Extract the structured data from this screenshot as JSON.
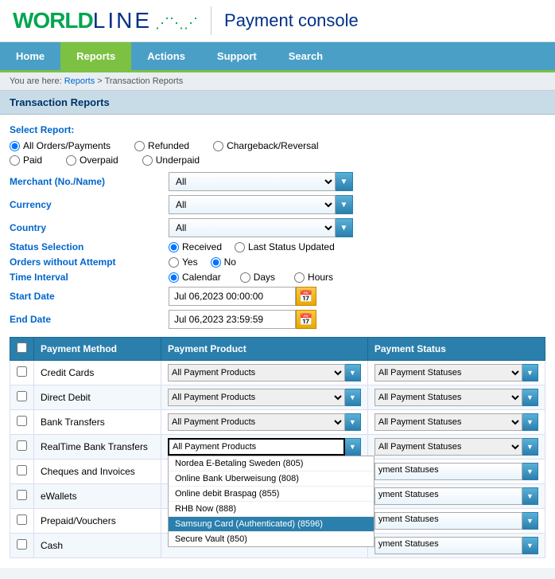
{
  "header": {
    "logo_world": "WORLD",
    "logo_line": "LINE",
    "logo_waves": "ʃʃʃ",
    "title": "Payment console"
  },
  "nav": {
    "items": [
      {
        "id": "home",
        "label": "Home",
        "active": false
      },
      {
        "id": "reports",
        "label": "Reports",
        "active": true
      },
      {
        "id": "actions",
        "label": "Actions",
        "active": false
      },
      {
        "id": "support",
        "label": "Support",
        "active": false
      },
      {
        "id": "search",
        "label": "Search",
        "active": false
      }
    ]
  },
  "breadcrumb": {
    "prefix": "You are here:",
    "links": [
      "Reports",
      "Transaction Reports"
    ]
  },
  "page_title": "Transaction Reports",
  "form": {
    "select_report_label": "Select Report:",
    "report_options_row1": [
      {
        "id": "all_orders",
        "label": "All Orders/Payments",
        "checked": true
      },
      {
        "id": "refunded",
        "label": "Refunded",
        "checked": false
      },
      {
        "id": "chargeback",
        "label": "Chargeback/Reversal",
        "checked": false
      }
    ],
    "report_options_row2": [
      {
        "id": "paid",
        "label": "Paid",
        "checked": false
      },
      {
        "id": "overpaid",
        "label": "Overpaid",
        "checked": false
      },
      {
        "id": "underpaid",
        "label": "Underpaid",
        "checked": false
      }
    ],
    "merchant_label": "Merchant (No./Name)",
    "merchant_value": "All",
    "currency_label": "Currency",
    "currency_value": "All",
    "country_label": "Country",
    "country_value": "All",
    "status_selection_label": "Status Selection",
    "status_options": [
      {
        "id": "received",
        "label": "Received",
        "checked": true
      },
      {
        "id": "last_status",
        "label": "Last Status Updated",
        "checked": false
      }
    ],
    "orders_without_label": "Orders without Attempt",
    "orders_without_options": [
      {
        "id": "yes",
        "label": "Yes",
        "checked": false
      },
      {
        "id": "no",
        "label": "No",
        "checked": true
      }
    ],
    "time_interval_label": "Time Interval",
    "time_interval_options": [
      {
        "id": "calendar",
        "label": "Calendar",
        "checked": true
      },
      {
        "id": "days",
        "label": "Days",
        "checked": false
      },
      {
        "id": "hours",
        "label": "Hours",
        "checked": false
      }
    ],
    "start_date_label": "Start Date",
    "start_date_value": "Jul 06,2023 00:00:00",
    "end_date_label": "End Date",
    "end_date_value": "Jul 06,2023 23:59:59"
  },
  "table": {
    "headers": [
      "",
      "Payment Method",
      "Payment Product",
      "Payment Status"
    ],
    "rows": [
      {
        "method": "Credit Cards",
        "product": "All Payment Products",
        "status": "All Payment Statuses"
      },
      {
        "method": "Direct Debit",
        "product": "All Payment Products",
        "status": "All Payment Statuses"
      },
      {
        "method": "Bank Transfers",
        "product": "All Payment Products",
        "status": "All Payment Statuses"
      },
      {
        "method": "RealTime Bank Transfers",
        "product": "All Payment Products",
        "status": "All Payment Statuses"
      },
      {
        "method": "Cheques and Invoices",
        "product": "",
        "status": "yment Statuses"
      },
      {
        "method": "eWallets",
        "product": "",
        "status": "yment Statuses"
      },
      {
        "method": "Prepaid/Vouchers",
        "product": "",
        "status": "yment Statuses"
      },
      {
        "method": "Cash",
        "product": "",
        "status": "yment Statuses"
      }
    ],
    "dropdown_open_row": 3,
    "dropdown_input_value": "All Payment Products",
    "dropdown_menu_items": [
      {
        "label": "Nordea E-Betaling Sweden (805)",
        "selected": false
      },
      {
        "label": "Online Bank Uberweisung (808)",
        "selected": false
      },
      {
        "label": "Online debit Braspag (855)",
        "selected": false
      },
      {
        "label": "RHB Now (888)",
        "selected": false
      },
      {
        "label": "Samsung Card (Authenticated) (8596)",
        "selected": true
      },
      {
        "label": "Secure Vault (850)",
        "selected": false
      }
    ]
  },
  "colors": {
    "green": "#7dc142",
    "blue_dark": "#003087",
    "blue_nav": "#4a9fc7",
    "blue_link": "#0066cc",
    "blue_table_header": "#2a7fad"
  }
}
